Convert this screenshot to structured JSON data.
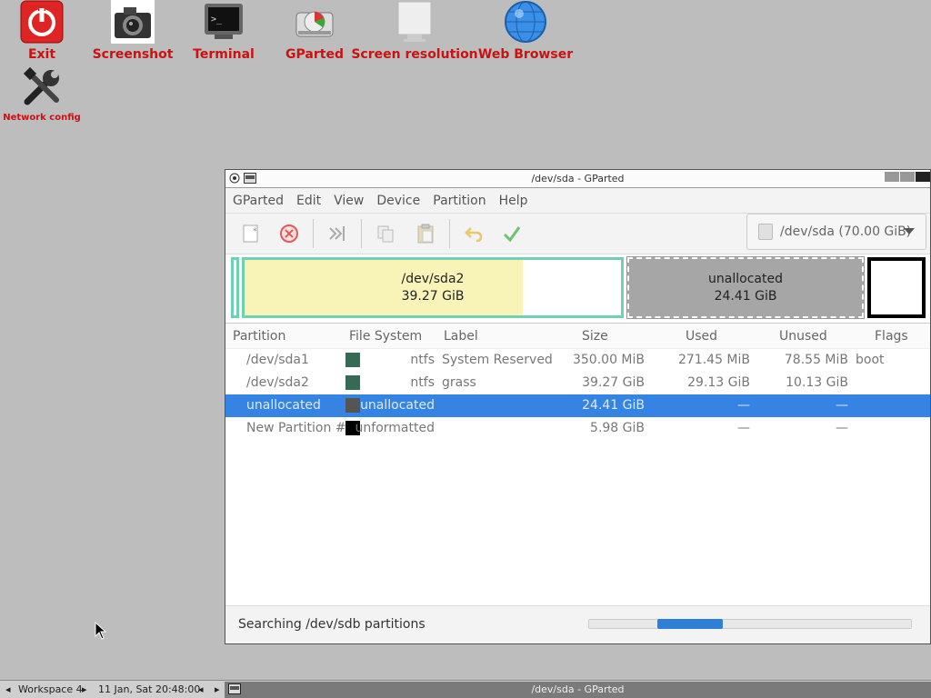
{
  "desktop": {
    "icons": [
      {
        "label": "Exit",
        "icon": "power-icon"
      },
      {
        "label": "Screenshot",
        "icon": "camera-icon"
      },
      {
        "label": "Terminal",
        "icon": "terminal-icon"
      },
      {
        "label": "GParted",
        "icon": "gparted-icon"
      },
      {
        "label": "Screen resolution",
        "icon": "monitor-icon"
      },
      {
        "label": "Web Browser",
        "icon": "globe-icon"
      },
      {
        "label": "Network config",
        "icon": "tools-icon"
      }
    ]
  },
  "window": {
    "title": "/dev/sda - GParted",
    "menu": [
      "GParted",
      "Edit",
      "View",
      "Device",
      "Partition",
      "Help"
    ],
    "device_selector": "/dev/sda (70.00 GiB)",
    "diskmap": {
      "sda2": {
        "name": "/dev/sda2",
        "size": "39.27 GiB",
        "used_fraction": 0.74
      },
      "unalloc": {
        "name": "unallocated",
        "size": "24.41 GiB"
      }
    },
    "columns": [
      "Partition",
      "File System",
      "Label",
      "Size",
      "Used",
      "Unused",
      "Flags"
    ],
    "rows": [
      {
        "partition": "/dev/sda1",
        "fs": "ntfs",
        "label": "System Reserved",
        "size": "350.00 MiB",
        "used": "271.45 MiB",
        "unused": "78.55 MiB",
        "flags": "boot",
        "color": "#356b54"
      },
      {
        "partition": "/dev/sda2",
        "fs": "ntfs",
        "label": "grass",
        "size": "39.27 GiB",
        "used": "29.13 GiB",
        "unused": "10.13 GiB",
        "flags": "",
        "color": "#356b54"
      },
      {
        "partition": "unallocated",
        "fs": "unallocated",
        "label": "",
        "size": "24.41 GiB",
        "used": "—",
        "unused": "—",
        "flags": "",
        "color": "#555555"
      },
      {
        "partition": "New Partition #1",
        "fs": "unformatted",
        "label": "",
        "size": "5.98 GiB",
        "used": "—",
        "unused": "—",
        "flags": "",
        "color": "#000000"
      }
    ],
    "status": "Searching /dev/sdb partitions"
  },
  "taskbar": {
    "workspace": "Workspace 4",
    "clock": "11 Jan, Sat 20:48:00",
    "task_title": "/dev/sda - GParted"
  },
  "colors": {
    "accent": "#3584e4",
    "desktop_label": "#cc1111",
    "sda2_used": "#f8f4b8",
    "partition_border": "#6fd1b0"
  }
}
